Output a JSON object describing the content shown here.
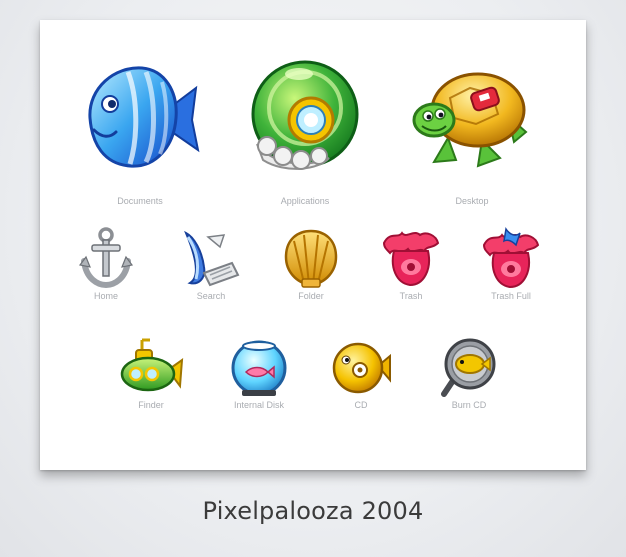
{
  "caption": "Pixelpalooza 2004",
  "icons": [
    {
      "label": "Documents",
      "icon": "fish-icon"
    },
    {
      "label": "Applications",
      "icon": "shell-snail-icon"
    },
    {
      "label": "Desktop",
      "icon": "turtle-icon"
    },
    {
      "label": "Home",
      "icon": "anchor-icon"
    },
    {
      "label": "Search",
      "icon": "magnifier-fish-icon"
    },
    {
      "label": "Folder",
      "icon": "scallop-shell-icon"
    },
    {
      "label": "Trash",
      "icon": "sea-anemone-icon"
    },
    {
      "label": "Trash Full",
      "icon": "sea-anemone-full-icon"
    },
    {
      "label": "Finder",
      "icon": "submarine-icon"
    },
    {
      "label": "Internal Disk",
      "icon": "fishbowl-icon"
    },
    {
      "label": "CD",
      "icon": "yellow-fish-cd-icon"
    },
    {
      "label": "Burn CD",
      "icon": "frying-pan-fish-icon"
    }
  ],
  "colors": {
    "background": "#eceef1",
    "card": "#ffffff",
    "label": "#a9acb1",
    "caption": "#3b3b3b"
  }
}
